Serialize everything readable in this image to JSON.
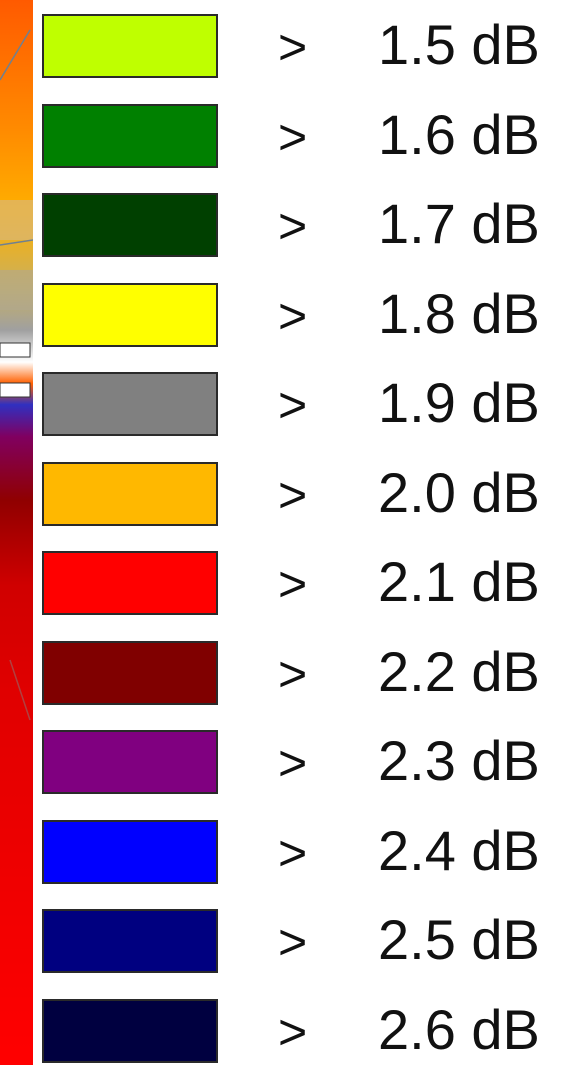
{
  "chart_data": {
    "type": "legend",
    "comparator": ">",
    "unit": "dB",
    "entries": [
      {
        "label": "1.5 dB",
        "value": 1.5,
        "color": "#bfff00"
      },
      {
        "label": "1.6 dB",
        "value": 1.6,
        "color": "#008000"
      },
      {
        "label": "1.7 dB",
        "value": 1.7,
        "color": "#004000"
      },
      {
        "label": "1.8 dB",
        "value": 1.8,
        "color": "#ffff00"
      },
      {
        "label": "1.9 dB",
        "value": 1.9,
        "color": "#808080"
      },
      {
        "label": "2.0 dB",
        "value": 2.0,
        "color": "#ffb800"
      },
      {
        "label": "2.1 dB",
        "value": 2.1,
        "color": "#ff0000"
      },
      {
        "label": "2.2 dB",
        "value": 2.2,
        "color": "#800000"
      },
      {
        "label": "2.3 dB",
        "value": 2.3,
        "color": "#800080"
      },
      {
        "label": "2.4 dB",
        "value": 2.4,
        "color": "#0000ff"
      },
      {
        "label": "2.5 dB",
        "value": 2.5,
        "color": "#000080"
      },
      {
        "label": "2.6 dB",
        "value": 2.6,
        "color": "#000040"
      }
    ]
  }
}
